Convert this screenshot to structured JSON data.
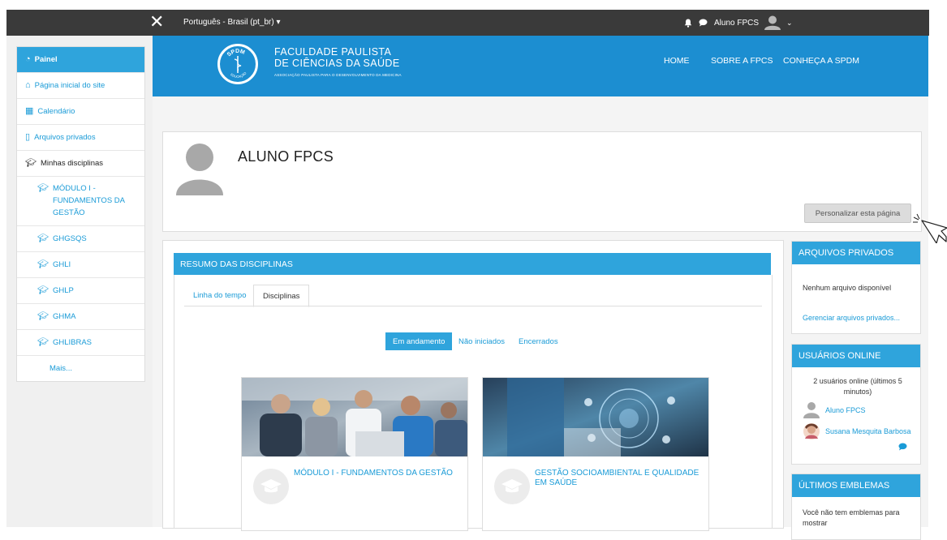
{
  "topbar": {
    "language": "Português - Brasil (pt_br)",
    "username": "Aluno FPCS"
  },
  "sidebar": {
    "items": [
      {
        "label": "Painel",
        "icon": "dashboard-icon"
      },
      {
        "label": "Página inicial do site",
        "icon": "home-icon"
      },
      {
        "label": "Calendário",
        "icon": "calendar-icon"
      },
      {
        "label": "Arquivos privados",
        "icon": "file-icon"
      },
      {
        "label": "Minhas disciplinas",
        "icon": "graduation-cap-icon"
      },
      {
        "label": "MÓDULO I - FUNDAMENTOS DA GESTÃO",
        "icon": "graduation-cap-icon"
      },
      {
        "label": "GHGSQS",
        "icon": "graduation-cap-icon"
      },
      {
        "label": "GHLI",
        "icon": "graduation-cap-icon"
      },
      {
        "label": "GHLP",
        "icon": "graduation-cap-icon"
      },
      {
        "label": "GHMA",
        "icon": "graduation-cap-icon"
      },
      {
        "label": "GHLIBRAS",
        "icon": "graduation-cap-icon"
      },
      {
        "label": "Mais..."
      }
    ]
  },
  "header": {
    "logo_text": "SPDM",
    "logo_subtext": "EDUCAÇÃO",
    "brand_line1": "FACULDADE PAULISTA",
    "brand_line2": "DE CIÊNCIAS DA SAÚDE",
    "brand_tagline": "ASSOCIAÇÃO PAULISTA PARA O DESENVOLVIMENTO DA MEDICINA",
    "nav": [
      "HOME",
      "SOBRE A FPCS",
      "CONHEÇA A SPDM"
    ]
  },
  "profile": {
    "name": "ALUNO FPCS",
    "customize_button": "Personalizar esta página"
  },
  "course_overview": {
    "title": "RESUMO DAS DISCIPLINAS",
    "tabs": [
      "Linha do tempo",
      "Disciplinas"
    ],
    "filters": [
      "Em andamento",
      "Não iniciados",
      "Encerrados"
    ],
    "courses": [
      {
        "title": "MÓDULO I - FUNDAMENTOS DA GESTÃO"
      },
      {
        "title": "GESTÃO SOCIOAMBIENTAL E QUALIDADE EM SAÚDE"
      }
    ]
  },
  "blocks": {
    "private_files": {
      "title": "ARQUIVOS PRIVADOS",
      "empty_text": "Nenhum arquivo disponível",
      "manage_link": "Gerenciar arquivos privados..."
    },
    "online_users": {
      "title": "USUÁRIOS ONLINE",
      "summary": "2 usuários online (últimos 5 minutos)",
      "users": [
        "Aluno FPCS",
        "Susana Mesquita Barbosa"
      ]
    },
    "badges": {
      "title": "ÚLTIMOS EMBLEMAS",
      "empty_text": "Você não tem emblemas para mostrar"
    }
  },
  "colors": {
    "primary": "#2fa4dc",
    "banner": "#1c8ed1",
    "topbar": "#3a3a3a"
  }
}
